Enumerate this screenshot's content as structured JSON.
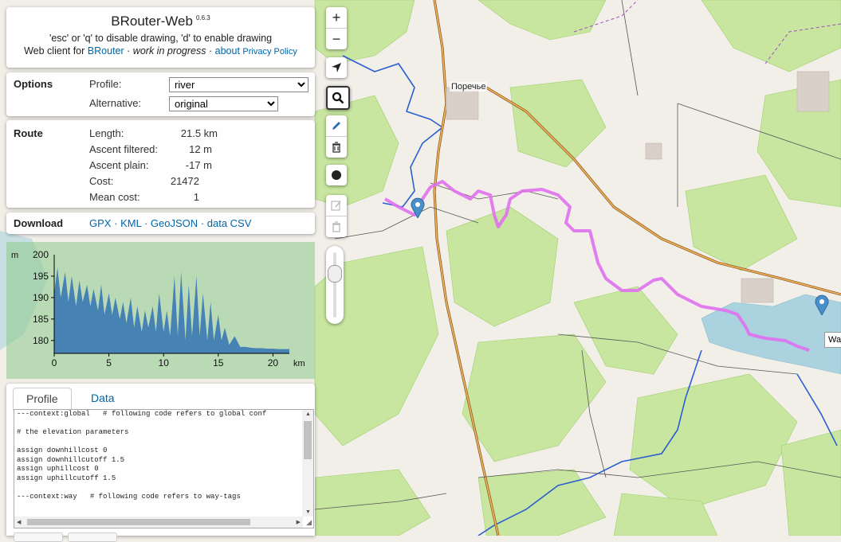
{
  "header": {
    "title": "BRouter-Web",
    "version": "0.6.3",
    "instruction": "'esc' or 'q' to disable drawing, 'd' to enable drawing",
    "client_prefix": "Web client for",
    "brouter_link": "BRouter",
    "sep1": "·",
    "wip": "work in progress",
    "sep2": "·",
    "about_link": "about",
    "privacy_link": "Privacy Policy"
  },
  "options": {
    "title": "Options",
    "profile_label": "Profile:",
    "profile_value": "river",
    "alternative_label": "Alternative:",
    "alternative_value": "original"
  },
  "route": {
    "title": "Route",
    "rows": [
      {
        "label": "Length:",
        "value": "21.5 km"
      },
      {
        "label": "Ascent filtered:",
        "value": "12 m"
      },
      {
        "label": "Ascent plain:",
        "value": "-17 m"
      },
      {
        "label": "Cost:",
        "value": "21472"
      },
      {
        "label": "Mean cost:",
        "value": "1"
      }
    ]
  },
  "download": {
    "title": "Download",
    "gpx": "GPX",
    "kml": "KML",
    "geojson": "GeoJSON",
    "csv": "data CSV",
    "sep": "·"
  },
  "chart_data": {
    "type": "area",
    "title": "",
    "xlabel": "km",
    "ylabel": "m",
    "xlim": [
      0,
      21.5
    ],
    "ylim": [
      177,
      200
    ],
    "x_ticks": [
      0,
      5,
      10,
      15,
      20
    ],
    "y_ticks": [
      180,
      185,
      190,
      195
    ],
    "y_top_label": "200",
    "series": [
      {
        "x": [
          0,
          0.3,
          0.6,
          1.0,
          1.3,
          1.6,
          2.0,
          2.3,
          2.6,
          3.0,
          3.3,
          3.6,
          4.0,
          4.3,
          4.6,
          5.0,
          5.3,
          5.6,
          6.0,
          6.3,
          6.6,
          7.0,
          7.3,
          7.6,
          8.0,
          8.3,
          8.6,
          9.0,
          9.3,
          9.6,
          10.0,
          10.3,
          10.6,
          11.0,
          11.3,
          11.6,
          12.0,
          12.3,
          12.6,
          13.0,
          13.3,
          13.6,
          14.0,
          14.3,
          14.6,
          15.0,
          15.3,
          15.6,
          16.0,
          16.5,
          17.0,
          17.5,
          18.0,
          18.5,
          19.0,
          19.5,
          20.0,
          20.5,
          21.0,
          21.5
        ],
        "y": [
          191,
          197,
          190,
          196,
          189,
          195,
          188,
          194,
          189,
          193,
          188,
          192,
          187,
          193,
          186,
          191,
          186,
          190,
          185,
          189,
          184,
          190,
          183,
          188,
          182,
          187,
          183,
          188,
          182,
          191,
          182,
          187,
          181,
          195,
          181,
          196,
          180,
          193,
          181,
          195,
          181,
          191,
          180,
          189,
          180,
          186,
          180,
          183,
          179,
          181,
          178.5,
          178.5,
          178.3,
          178.2,
          178.2,
          178.1,
          178.1,
          178,
          178,
          178
        ]
      }
    ],
    "color": "#4682b4",
    "grid": false
  },
  "profile_tabs": {
    "profile": "Profile",
    "data": "Data"
  },
  "code_lines": [
    "---context:global   # following code refers to global conf",
    "",
    "# the elevation parameters",
    "",
    "assign downhillcost 0",
    "assign downhillcutoff 1.5",
    "assign uphillcost 0",
    "assign uphillcutoff 1.5",
    "",
    "---context:way   # following code refers to way-tags"
  ],
  "map": {
    "place_label": "Поречье",
    "tooltip": "Wa",
    "route_color": "#e070f0",
    "water_color": "#aad3df",
    "forest_color": "#c8e6a0"
  },
  "controls": {
    "zoom_in": "+",
    "zoom_out": "−"
  }
}
